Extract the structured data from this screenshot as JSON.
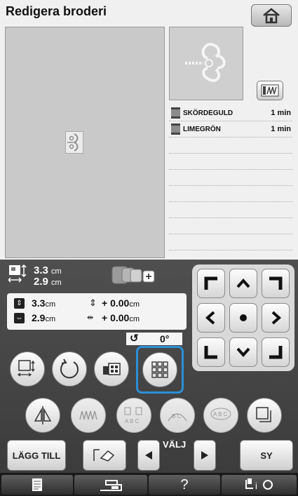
{
  "header": {
    "title": "Redigera broderi"
  },
  "threads": [
    {
      "name": "SKÖRDEGULD",
      "time": "1 min",
      "color": "#8a8a8a"
    },
    {
      "name": "LIMEGRÖN",
      "time": "1 min",
      "color": "#8a8a8a"
    },
    {
      "name": "",
      "time": ""
    },
    {
      "name": "",
      "time": ""
    },
    {
      "name": "",
      "time": ""
    },
    {
      "name": "",
      "time": ""
    },
    {
      "name": "",
      "time": ""
    },
    {
      "name": "",
      "time": ""
    },
    {
      "name": "",
      "time": ""
    }
  ],
  "size_display": {
    "height_value": "3.3",
    "height_unit": "cm",
    "width_value": "2.9",
    "width_unit": "cm"
  },
  "values": {
    "height_value": "3.3",
    "height_unit": "cm",
    "width_value": "2.9",
    "width_unit": "cm",
    "vmove_value": "+ 0.00",
    "vmove_unit": "cm",
    "hmove_value": "+ 0.00",
    "hmove_unit": "cm",
    "rotation": "0°"
  },
  "buttons": {
    "add": "LÄGG TILL",
    "select": "VÄLJ",
    "sew": "SY"
  },
  "colors": {
    "highlight": "#2b8fd6",
    "panel": "#444444"
  }
}
